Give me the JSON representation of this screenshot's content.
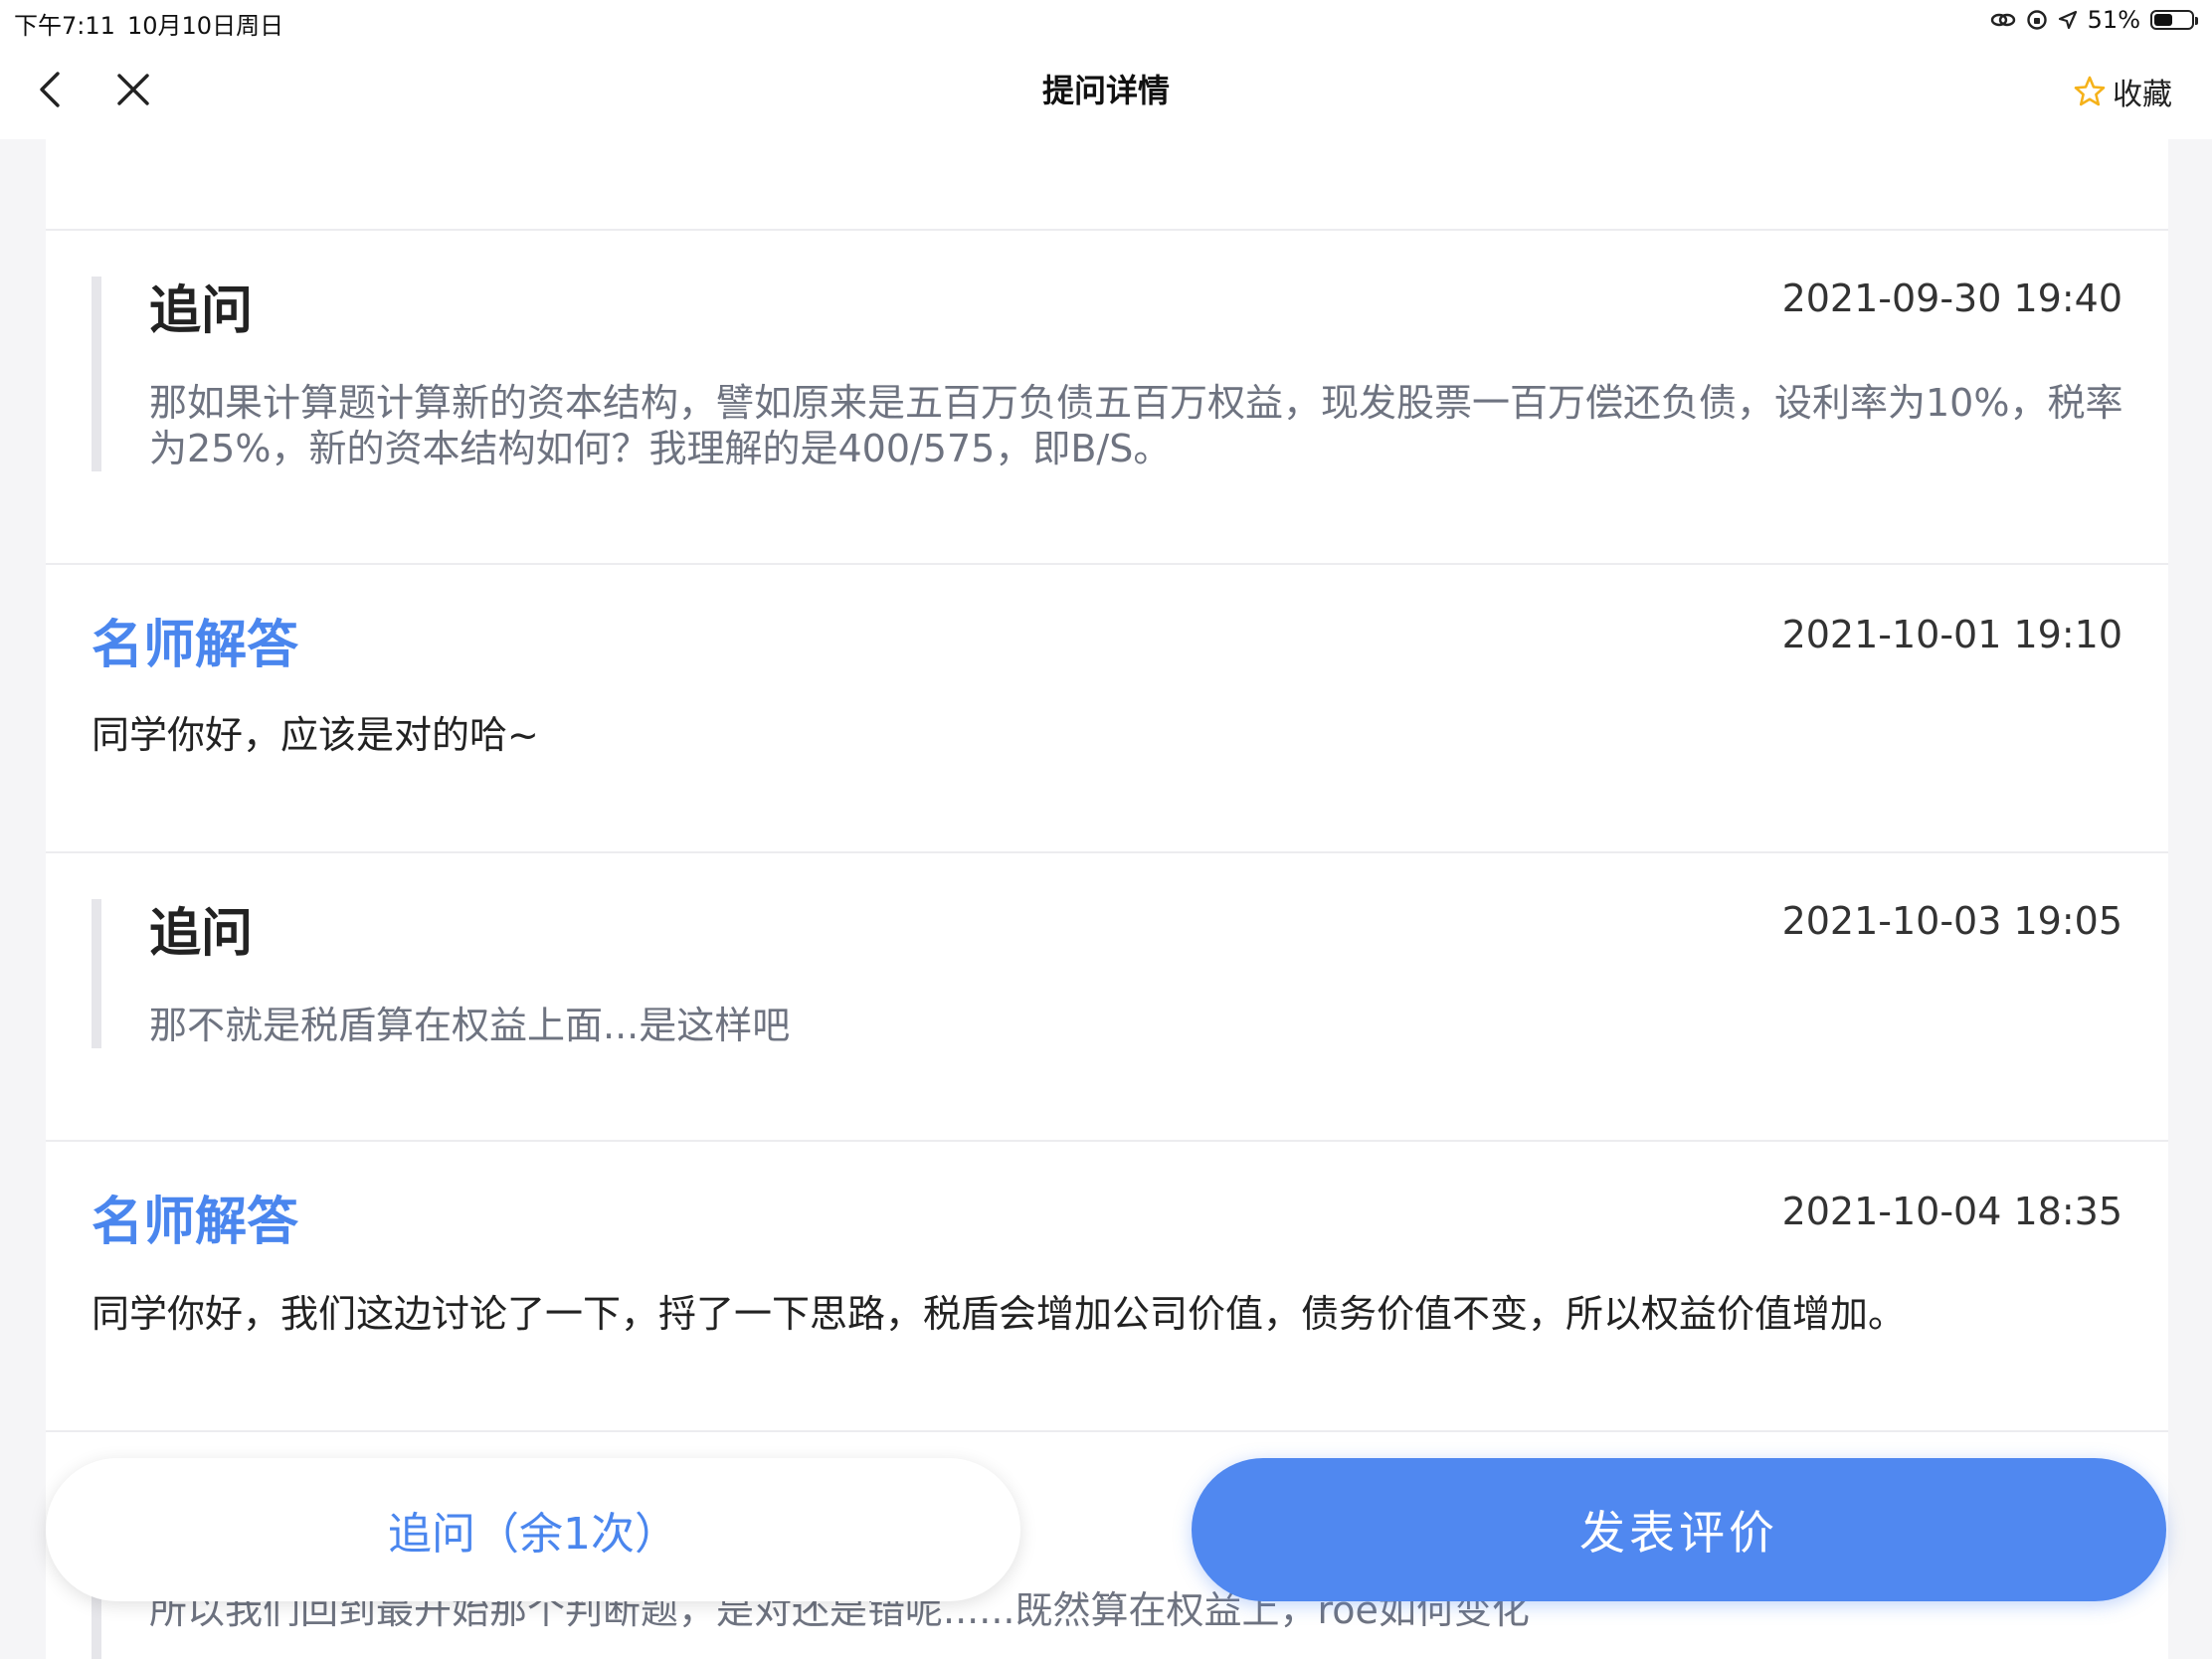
{
  "status_bar": {
    "time": "下午7:11",
    "date": "10月10日周日",
    "battery_text": "51%",
    "battery_level": 0.51
  },
  "nav": {
    "title": "提问详情",
    "favorite_label": "收藏"
  },
  "thread": [
    {
      "type": "followup",
      "heading": "追问",
      "time": "2021-09-30 19:40",
      "text": "那如果计算题计算新的资本结构，譬如原来是五百万负债五百万权益，现发股票一百万偿还负债，设利率为10%，税率为25%，新的资本结构如何？我理解的是400/575，即B/S。"
    },
    {
      "type": "answer",
      "heading": "名师解答",
      "time": "2021-10-01 19:10",
      "text": "同学你好，应该是对的哈~"
    },
    {
      "type": "followup",
      "heading": "追问",
      "time": "2021-10-03 19:05",
      "text": "那不就是税盾算在权益上面...是这样吧"
    },
    {
      "type": "answer",
      "heading": "名师解答",
      "time": "2021-10-04 18:35",
      "text": "同学你好，我们这边讨论了一下，捋了一下思路，税盾会增加公司价值，债务价值不变，所以权益价值增加。"
    },
    {
      "type": "followup",
      "text": "所以我们回到最开始那个判断题，是对还是错呢......既然算在权益上，roe如何变化"
    }
  ],
  "actions": {
    "followup_label": "追问（余1次）",
    "review_label": "发表评价"
  },
  "colors": {
    "accent": "#4a86ee",
    "primary_button": "#5088f0",
    "favorite_star": "#f5b21a"
  }
}
